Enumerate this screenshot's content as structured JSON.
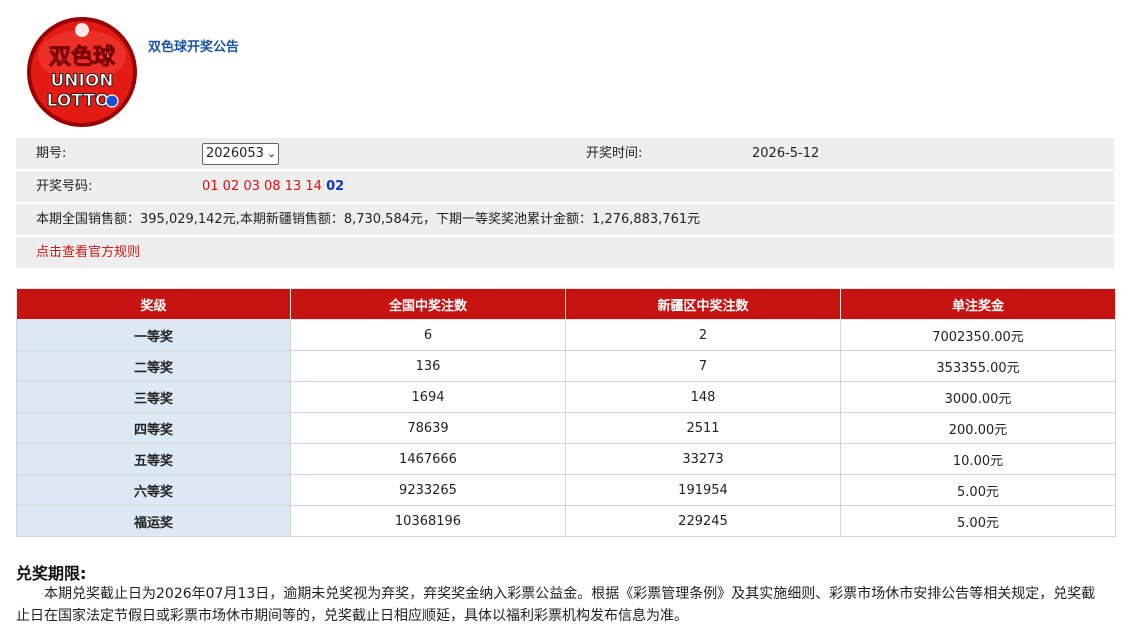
{
  "header": {
    "title": "双色球开奖公告",
    "logo_text": "双色球 UNION LOTTO",
    "logo_cn": "双色球",
    "logo_en1": "UNION",
    "logo_en2": "LOTTO"
  },
  "info": {
    "issue_label": "期号:",
    "issue_value": "2026053",
    "draw_time_label": "开奖时间:",
    "draw_time_value": "2026-5-12",
    "numbers_label": "开奖号码:",
    "red_balls": "01 02 03 08 13 14",
    "blue_ball": "02",
    "sales_text": "本期全国销售额：395,029,142元,本期新疆销售额：8,730,584元，下期一等奖奖池累计金额：1,276,883,761元",
    "rules_link": "点击查看官方规则"
  },
  "table": {
    "headers": [
      "奖级",
      "全国中奖注数",
      "新疆区中奖注数",
      "单注奖金"
    ],
    "rows": [
      [
        "一等奖",
        "6",
        "2",
        "7002350.00元"
      ],
      [
        "二等奖",
        "136",
        "7",
        "353355.00元"
      ],
      [
        "三等奖",
        "1694",
        "148",
        "3000.00元"
      ],
      [
        "四等奖",
        "78639",
        "2511",
        "200.00元"
      ],
      [
        "五等奖",
        "1467666",
        "33273",
        "10.00元"
      ],
      [
        "六等奖",
        "9233265",
        "191954",
        "5.00元"
      ],
      [
        "福运奖",
        "10368196",
        "229245",
        "5.00元"
      ]
    ]
  },
  "deadline": {
    "title": "兑奖期限:",
    "text": "本期兑奖截止日为2026年07月13日，逾期未兑奖视为弃奖，弃奖奖金纳入彩票公益金。根据《彩票管理条例》及其实施细则、彩票市场休市安排公告等相关规定，兑奖截止日在国家法定节假日或彩票市场休市期间等的，兑奖截止日相应顺延，具体以福利彩票机构发布信息为准。"
  },
  "colors": {
    "header_red": "#c61412",
    "level_bg": "#dde8f5",
    "red_ball": "#e01010",
    "blue_ball": "#1633c4",
    "title_blue": "#1a55a8"
  }
}
